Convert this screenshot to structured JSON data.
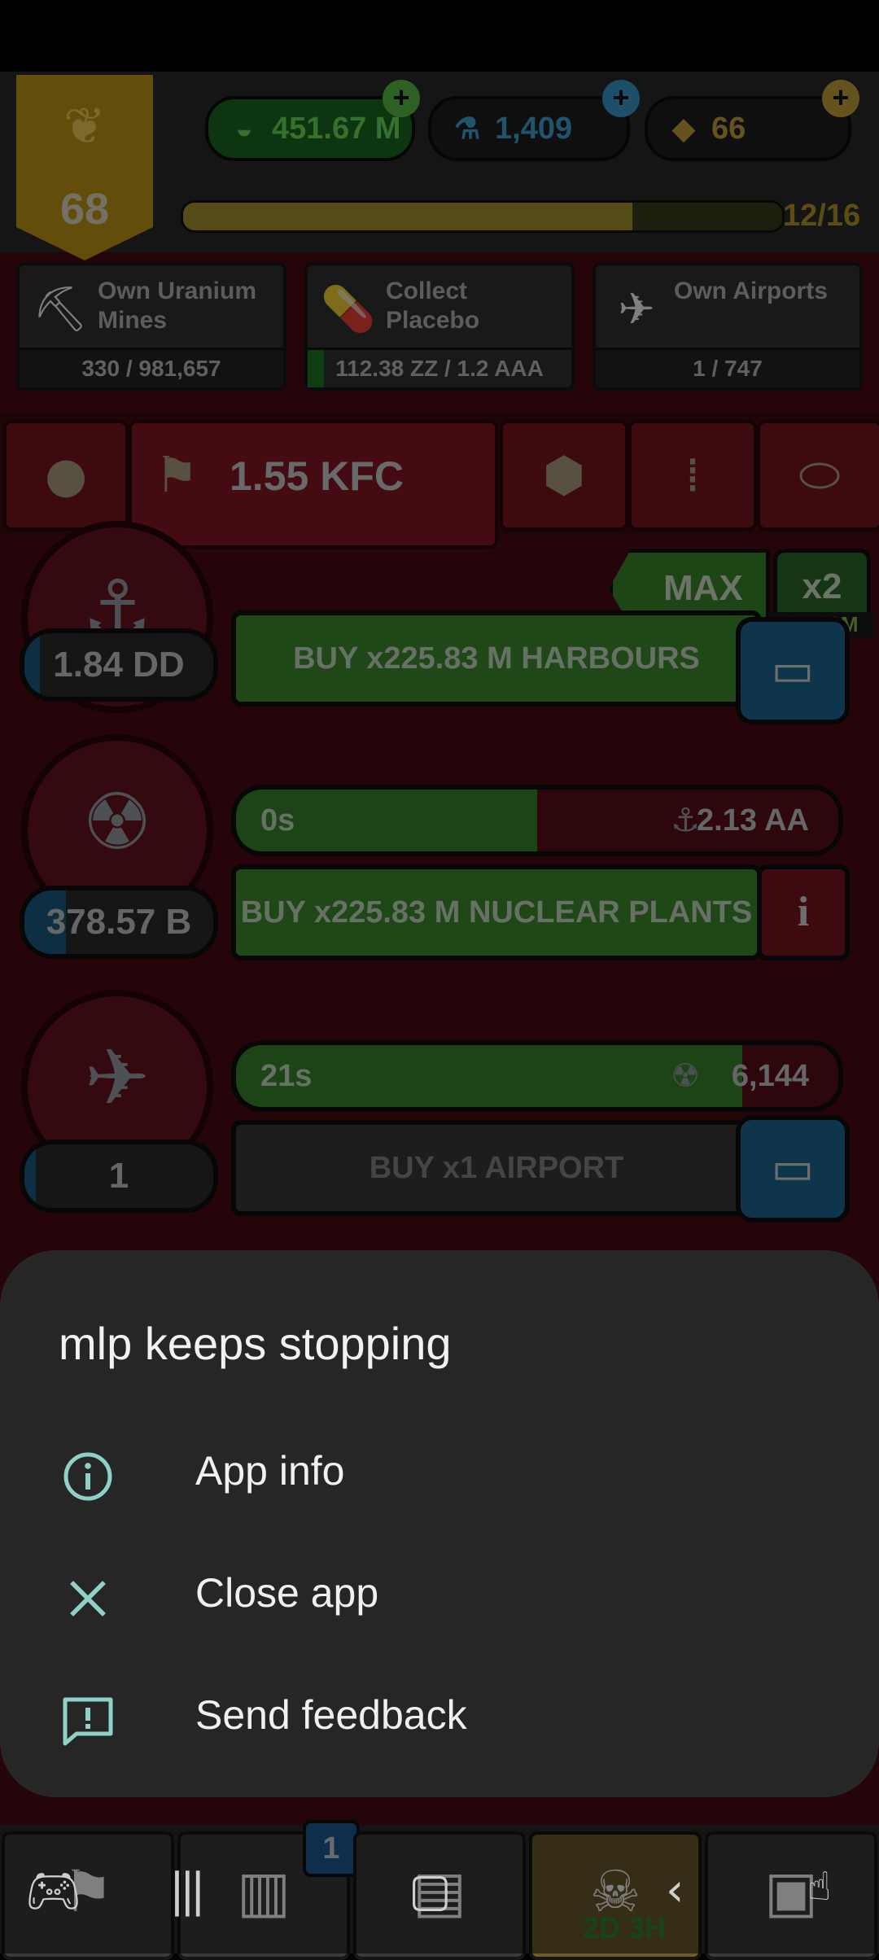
{
  "game": {
    "level": "68",
    "currencies": {
      "cash": "451.67 M",
      "research": "1,409",
      "gold": "66"
    },
    "xp": {
      "label": "12/16",
      "fraction": 0.75
    },
    "goals": [
      {
        "title": "Own Uranium Mines",
        "progress": "330 / 981,657",
        "fraction": 0.0003
      },
      {
        "title": "Collect Placebo",
        "progress": "112.38 ZZ / 1.2 AAA",
        "fraction": 0.06
      },
      {
        "title": "Own Airports",
        "progress": "1 / 747",
        "fraction": 0.001
      }
    ],
    "active_tab_value": "1.55 KFC",
    "max_label": "MAX",
    "multiplier_label": "x2",
    "multiplier_timer": "3H 39M",
    "rows": [
      {
        "count": "1.84 DD",
        "count_fraction": 0.08,
        "buy_label": "BUY x225.83 M HARBOURS",
        "buy_enabled": true
      },
      {
        "count": "378.57 B",
        "count_fraction": 0.22,
        "time": "0s",
        "progress_fraction": 0.5,
        "output": "2.13 AA",
        "buy_label": "BUY x225.83 M NUCLEAR PLANTS",
        "buy_enabled": true
      },
      {
        "count": "1",
        "count_fraction": 0.06,
        "time": "21s",
        "progress_fraction": 0.84,
        "output": "6,144",
        "buy_label": "BUY x1 AIRPORT",
        "buy_enabled": false
      }
    ],
    "nav": {
      "cards_badge": "1",
      "event_timer": "2D 3H"
    }
  },
  "dialog": {
    "title": "mlp keeps stopping",
    "items": [
      {
        "label": "App info",
        "icon": "info-icon"
      },
      {
        "label": "Close app",
        "icon": "close-icon"
      },
      {
        "label": "Send feedback",
        "icon": "feedback-icon"
      }
    ],
    "accent_color": "#8fd1c7"
  }
}
